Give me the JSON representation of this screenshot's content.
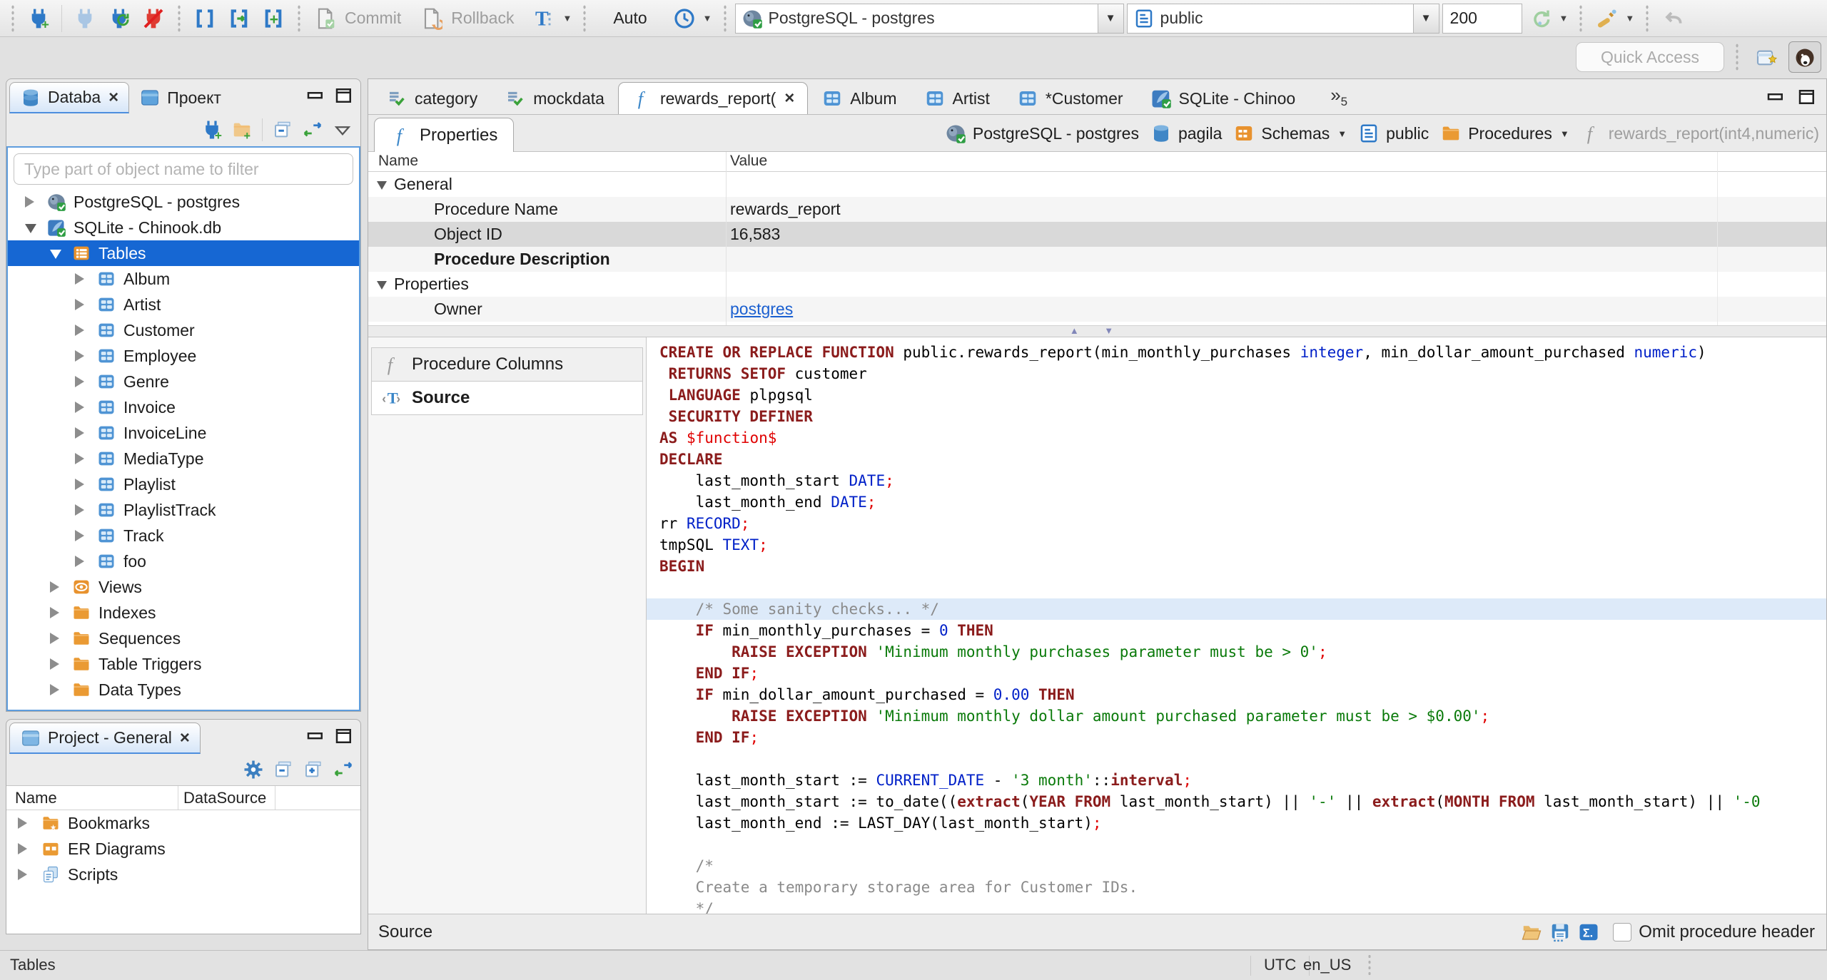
{
  "toolbar": {
    "auto_label": "Auto",
    "commit_label": "Commit",
    "rollback_label": "Rollback",
    "connection_combo": "PostgreSQL - postgres",
    "schema_combo": "public",
    "fetch_size": "200",
    "quick_access_placeholder": "Quick Access"
  },
  "sidebar": {
    "tabs": [
      {
        "label": "Databa",
        "icon": "db-stack",
        "active": true,
        "closable": true
      },
      {
        "label": "Проект",
        "icon": "window",
        "active": false,
        "closable": false
      }
    ],
    "filter_placeholder": "Type part of object name to filter",
    "tree": [
      {
        "label": "PostgreSQL - postgres",
        "icon": "postgres",
        "state": "collapsed",
        "indent": 0
      },
      {
        "label": "SQLite - Chinook.db",
        "icon": "sqlite",
        "state": "expanded",
        "indent": 0
      },
      {
        "label": "Tables",
        "icon": "table-folder",
        "state": "expanded",
        "indent": 1,
        "selected": true
      },
      {
        "label": "Album",
        "icon": "table",
        "state": "collapsed",
        "indent": 2
      },
      {
        "label": "Artist",
        "icon": "table",
        "state": "collapsed",
        "indent": 2
      },
      {
        "label": "Customer",
        "icon": "table",
        "state": "collapsed",
        "indent": 2
      },
      {
        "label": "Employee",
        "icon": "table",
        "state": "collapsed",
        "indent": 2
      },
      {
        "label": "Genre",
        "icon": "table",
        "state": "collapsed",
        "indent": 2
      },
      {
        "label": "Invoice",
        "icon": "table",
        "state": "collapsed",
        "indent": 2
      },
      {
        "label": "InvoiceLine",
        "icon": "table",
        "state": "collapsed",
        "indent": 2
      },
      {
        "label": "MediaType",
        "icon": "table",
        "state": "collapsed",
        "indent": 2
      },
      {
        "label": "Playlist",
        "icon": "table",
        "state": "collapsed",
        "indent": 2
      },
      {
        "label": "PlaylistTrack",
        "icon": "table",
        "state": "collapsed",
        "indent": 2
      },
      {
        "label": "Track",
        "icon": "table",
        "state": "collapsed",
        "indent": 2
      },
      {
        "label": "foo",
        "icon": "table",
        "state": "collapsed",
        "indent": 2
      },
      {
        "label": "Views",
        "icon": "eye-views",
        "state": "collapsed",
        "indent": 1
      },
      {
        "label": "Indexes",
        "icon": "folder",
        "state": "collapsed",
        "indent": 1
      },
      {
        "label": "Sequences",
        "icon": "folder",
        "state": "collapsed",
        "indent": 1
      },
      {
        "label": "Table Triggers",
        "icon": "folder",
        "state": "collapsed",
        "indent": 1
      },
      {
        "label": "Data Types",
        "icon": "folder",
        "state": "collapsed",
        "indent": 1
      }
    ]
  },
  "project_panel": {
    "tab_label": "Project - General",
    "columns": [
      "Name",
      "DataSource"
    ],
    "rows": [
      {
        "label": "Bookmarks",
        "icon": "bookmarks-folder"
      },
      {
        "label": "ER Diagrams",
        "icon": "er-folder"
      },
      {
        "label": "Scripts",
        "icon": "scripts"
      }
    ]
  },
  "editor": {
    "tabs": [
      {
        "label": "category",
        "icon": "script-check",
        "active": false,
        "closable": false
      },
      {
        "label": "mockdata",
        "icon": "script-check",
        "active": false,
        "closable": false
      },
      {
        "label": "rewards_report(",
        "icon": "function-f",
        "active": true,
        "closable": true
      },
      {
        "label": "Album",
        "icon": "table",
        "active": false,
        "closable": false
      },
      {
        "label": "Artist",
        "icon": "table",
        "active": false,
        "closable": false
      },
      {
        "label": "*Customer",
        "icon": "table",
        "active": false,
        "closable": false
      },
      {
        "label": "SQLite - Chinoo",
        "icon": "sqlite",
        "active": false,
        "closable": false
      }
    ],
    "overflow_count": "5"
  },
  "object_editor": {
    "properties_tab_label": "Properties",
    "breadcrumb": [
      {
        "label": "PostgreSQL - postgres",
        "icon": "postgres",
        "dropdown": false,
        "muted": false
      },
      {
        "label": "pagila",
        "icon": "db-cylinder",
        "dropdown": false,
        "muted": false
      },
      {
        "label": "Schemas",
        "icon": "schemas-folder",
        "dropdown": true,
        "muted": false
      },
      {
        "label": "public",
        "icon": "schema-page",
        "dropdown": false,
        "muted": false
      },
      {
        "label": "Procedures",
        "icon": "folder",
        "dropdown": true,
        "muted": false
      },
      {
        "label": "rewards_report(int4,numeric)",
        "icon": "function-gray",
        "dropdown": false,
        "muted": true
      }
    ],
    "grid": {
      "columns": [
        "Name",
        "Value"
      ],
      "rows": [
        {
          "name": "General",
          "group": true
        },
        {
          "name": "Procedure Name",
          "value": "rewards_report"
        },
        {
          "name": "Object ID",
          "value": "16,583",
          "selected": true
        },
        {
          "name": "Procedure Description",
          "bold": true
        },
        {
          "name": "Properties",
          "group": true
        },
        {
          "name": "Owner",
          "value": "postgres",
          "link": true
        }
      ]
    },
    "side_tabs": [
      {
        "label": "Procedure Columns",
        "icon": "function-gray"
      },
      {
        "label": "Source",
        "icon": "source-T",
        "active": true
      }
    ],
    "footer": {
      "label": "Source",
      "omit_label": "Omit procedure header"
    }
  },
  "code": {
    "highlight_line": 13,
    "lines": [
      [
        [
          "k",
          "CREATE OR REPLACE FUNCTION"
        ],
        [
          "p",
          " public.rewards_report(min_monthly_purchases "
        ],
        [
          "t",
          "integer"
        ],
        [
          "p",
          ", min_dollar_amount_purchased "
        ],
        [
          "t",
          "numeric"
        ],
        [
          "p",
          ")"
        ]
      ],
      [
        [
          "k",
          " RETURNS SETOF"
        ],
        [
          "p",
          " customer"
        ]
      ],
      [
        [
          "k",
          " LANGUAGE"
        ],
        [
          "p",
          " plpgsql"
        ]
      ],
      [
        [
          "k",
          " SECURITY DEFINER"
        ]
      ],
      [
        [
          "k",
          "AS "
        ],
        [
          "r",
          "$function$"
        ]
      ],
      [
        [
          "k",
          "DECLARE"
        ]
      ],
      [
        [
          "p",
          "    last_month_start "
        ],
        [
          "t",
          "DATE"
        ],
        [
          "r",
          ";"
        ]
      ],
      [
        [
          "p",
          "    last_month_end "
        ],
        [
          "t",
          "DATE"
        ],
        [
          "r",
          ";"
        ]
      ],
      [
        [
          "p",
          "rr "
        ],
        [
          "t",
          "RECORD"
        ],
        [
          "r",
          ";"
        ]
      ],
      [
        [
          "p",
          "tmpSQL "
        ],
        [
          "t",
          "TEXT"
        ],
        [
          "r",
          ";"
        ]
      ],
      [
        [
          "k",
          "BEGIN"
        ]
      ],
      [],
      [
        [
          "c",
          "    /* Some sanity checks... */"
        ]
      ],
      [
        [
          "k",
          "    IF"
        ],
        [
          "p",
          " min_monthly_purchases = "
        ],
        [
          "t",
          "0"
        ],
        [
          "k",
          " THEN"
        ]
      ],
      [
        [
          "k",
          "        RAISE EXCEPTION "
        ],
        [
          "s",
          "'Minimum monthly purchases parameter must be > 0'"
        ],
        [
          "r",
          ";"
        ]
      ],
      [
        [
          "k",
          "    END IF"
        ],
        [
          "r",
          ";"
        ]
      ],
      [
        [
          "k",
          "    IF"
        ],
        [
          "p",
          " min_dollar_amount_purchased = "
        ],
        [
          "t",
          "0.00"
        ],
        [
          "k",
          " THEN"
        ]
      ],
      [
        [
          "k",
          "        RAISE EXCEPTION "
        ],
        [
          "s",
          "'Minimum monthly dollar amount purchased parameter must be > $0.00'"
        ],
        [
          "r",
          ";"
        ]
      ],
      [
        [
          "k",
          "    END IF"
        ],
        [
          "r",
          ";"
        ]
      ],
      [],
      [
        [
          "p",
          "    last_month_start := "
        ],
        [
          "t",
          "CURRENT_DATE"
        ],
        [
          "p",
          " - "
        ],
        [
          "s",
          "'3 month'"
        ],
        [
          "p",
          "::"
        ],
        [
          "k",
          "interval"
        ],
        [
          "r",
          ";"
        ]
      ],
      [
        [
          "p",
          "    last_month_start := to_date(("
        ],
        [
          "k",
          "extract"
        ],
        [
          "p",
          "("
        ],
        [
          "k",
          "YEAR FROM"
        ],
        [
          "p",
          " last_month_start) || "
        ],
        [
          "s",
          "'-'"
        ],
        [
          "p",
          " || "
        ],
        [
          "k",
          "extract"
        ],
        [
          "p",
          "("
        ],
        [
          "k",
          "MONTH FROM"
        ],
        [
          "p",
          " last_month_start) || "
        ],
        [
          "s",
          "'-0"
        ]
      ],
      [
        [
          "p",
          "    last_month_end := LAST_DAY(last_month_start)"
        ],
        [
          "r",
          ";"
        ]
      ],
      [],
      [
        [
          "c",
          "    /*"
        ]
      ],
      [
        [
          "c",
          "    Create a temporary storage area for Customer IDs."
        ]
      ],
      [
        [
          "c",
          "    */"
        ]
      ]
    ]
  },
  "status_bar": {
    "left": "Tables",
    "timezone": "UTC",
    "locale": "en_US"
  }
}
